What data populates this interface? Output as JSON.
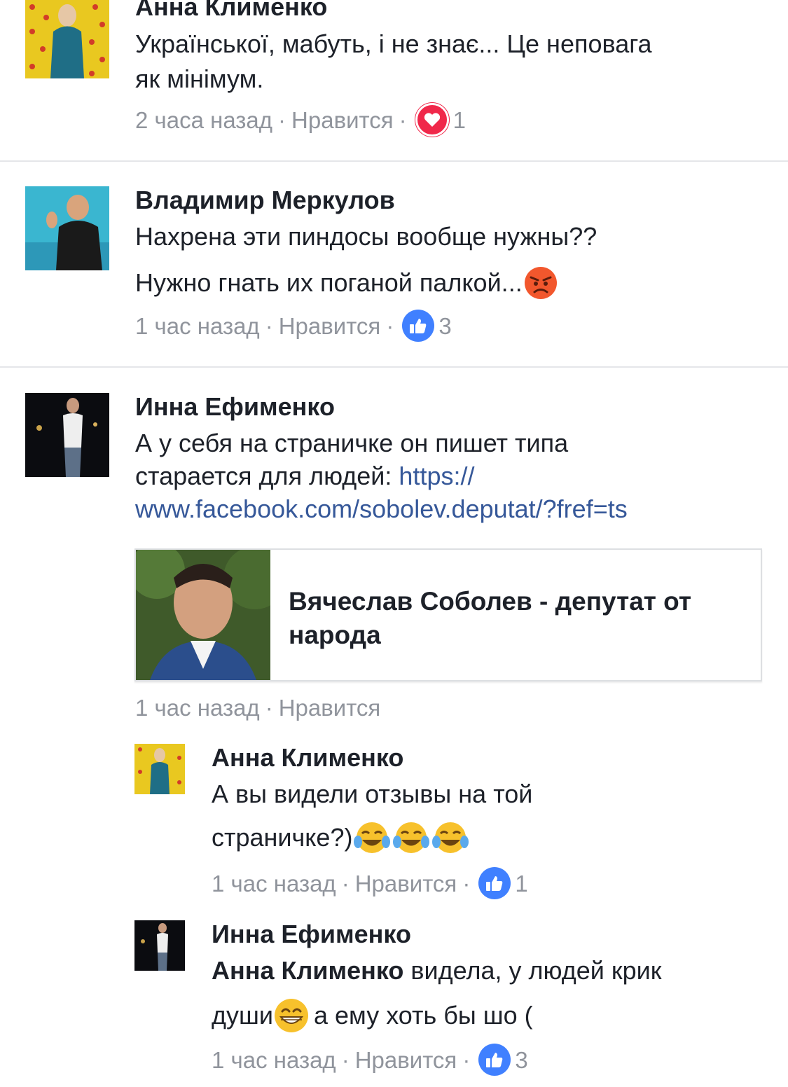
{
  "comments": [
    {
      "author": "Анна Клименко",
      "lines": [
        "Української, мабуть, і не знає... Це неповага",
        "як мінімум."
      ],
      "time": "2 часа назад",
      "like_label": "Нравится",
      "reaction": "love",
      "reaction_count": "1"
    },
    {
      "author": "Владимир Меркулов",
      "lines": [
        "Нахрена эти пиндосы вообще нужны??",
        "Нужно гнать их поганой палкой..."
      ],
      "time": "1 час назад",
      "like_label": "Нравится",
      "reaction": "like",
      "reaction_count": "3"
    },
    {
      "author": "Инна Ефименко",
      "lines": [
        "А у себя на страничке он пишет типа",
        "старается для людей: "
      ],
      "link_part1": "https://",
      "link_part2": "www.facebook.com/sobolev.deputat/?fref=ts",
      "card_title": "Вячеслав Соболев - депутат от народа",
      "time": "1 час назад",
      "like_label": "Нравится"
    }
  ],
  "replies": [
    {
      "author": "Анна Клименко",
      "lines": [
        "А вы видели отзывы на той",
        "страничке?)"
      ],
      "time": "1 час назад",
      "like_label": "Нравится",
      "reaction": "like",
      "reaction_count": "1"
    },
    {
      "author": "Инна Ефименко",
      "mention": "Анна Клименко",
      "lines": [
        " видела, у людей крик",
        "души ",
        " а ему хоть бы шо ("
      ],
      "time": "1 час назад",
      "like_label": "Нравится",
      "reaction": "like",
      "reaction_count": "3"
    }
  ],
  "separator": "·",
  "colors": {
    "link": "#365899",
    "meta": "#90949c",
    "like": "#4080ff",
    "love": "#f0284a"
  }
}
